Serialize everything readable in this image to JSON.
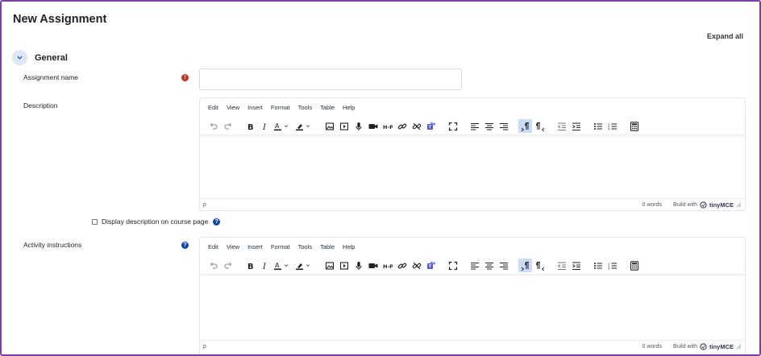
{
  "page": {
    "title": "New Assignment",
    "expand_all": "Expand all"
  },
  "section": {
    "title": "General"
  },
  "fields": {
    "assignment_name": {
      "label": "Assignment name",
      "required_icon": "!"
    },
    "description": {
      "label": "Description"
    },
    "display_description": {
      "label": "Display description on course page",
      "help_icon": "?"
    },
    "activity_instructions": {
      "label": "Activity instructions",
      "help_icon": "?"
    }
  },
  "editor": {
    "menu": [
      "Edit",
      "View",
      "Insert",
      "Format",
      "Tools",
      "Table",
      "Help"
    ],
    "status_path": "p",
    "word_count": "0 words",
    "build_with": "Build with",
    "brand": "tinyMCE"
  },
  "colors": {
    "frame": "#7a3ea5",
    "required": "#ca3120",
    "help": "#0f47ad",
    "accent": "#dce8f5"
  }
}
